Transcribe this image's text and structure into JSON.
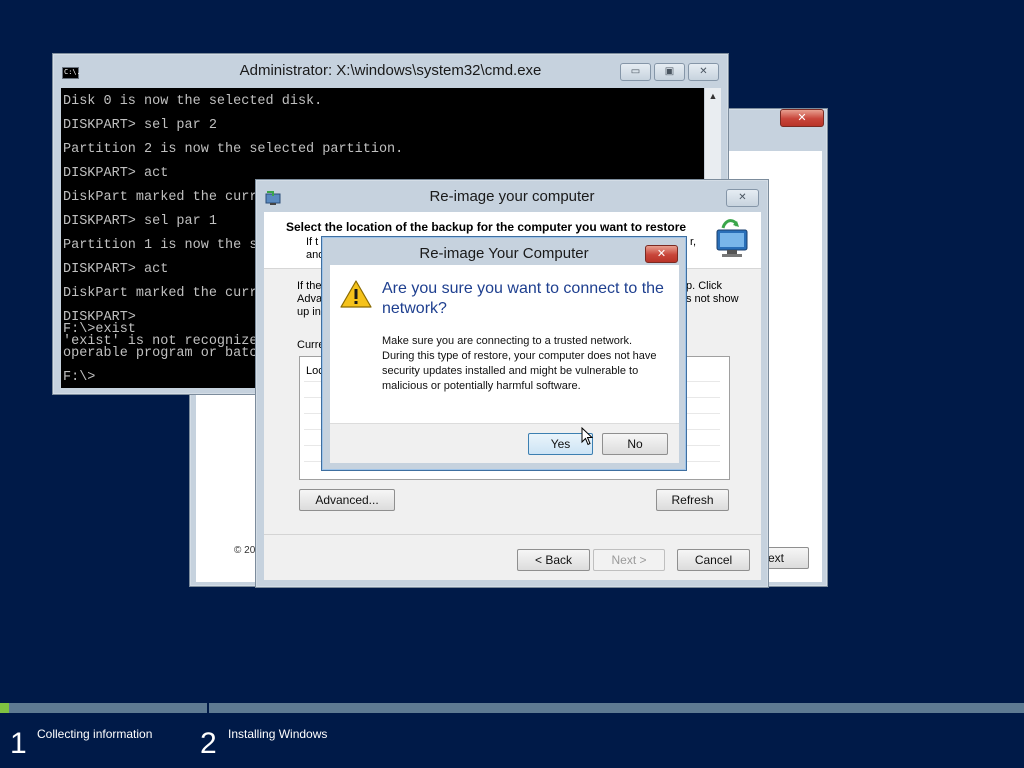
{
  "cmd": {
    "title": "Administrator: X:\\windows\\system32\\cmd.exe",
    "icon": "C:\\.",
    "lines": [
      "Disk 0 is now the selected disk.",
      "DISKPART> sel par 2",
      "Partition 2 is now the selected partition.",
      "DISKPART> act",
      "DiskPart marked the curr",
      "DISKPART> sel par 1",
      "Partition 1 is now the se",
      "DISKPART> act",
      "DiskPart marked the curr",
      "DISKPART>",
      "F:\\>exist",
      "'exist' is not recognized",
      "operable program or batc",
      "F:\\>"
    ],
    "buttons": {
      "minimize": "▭",
      "maximize": "▣",
      "close": "✕"
    }
  },
  "setup_window": {
    "close": "✕",
    "copyright": "© 20",
    "next_partial": "ext"
  },
  "wizard": {
    "title": "Re-image your computer",
    "close": "✕",
    "heading": "Select the location of the backup for the computer you want to restore",
    "sub_left_1": "If t",
    "sub_left_2": "and",
    "sub_right": "r,",
    "body_left_1": "If the",
    "body_left_2": "Adva",
    "body_left_3": "up in",
    "body_right_1": "p. Click",
    "body_right_2": "s not show",
    "current_label": "Curre",
    "list_header": "Loc",
    "advanced_button": "Advanced...",
    "refresh_button": "Refresh",
    "back_button": "< Back",
    "next_button": "Next >",
    "cancel_button": "Cancel"
  },
  "confirm": {
    "title": "Re-image Your Computer",
    "close": "✕",
    "question": "Are you sure you want to connect to the network?",
    "message": "Make sure you are connecting to a trusted network. During this type of restore, your computer does not have security updates installed and might be vulnerable to malicious or potentially harmful software.",
    "yes_button": "Yes",
    "no_button": "No"
  },
  "progress": {
    "steps": [
      {
        "number": "1",
        "label": "Collecting information"
      },
      {
        "number": "2",
        "label": "Installing Windows"
      }
    ]
  },
  "colors": {
    "desktop": "#001a48",
    "progress_done": "#7fc241",
    "heading_blue": "#1e3f8f"
  }
}
